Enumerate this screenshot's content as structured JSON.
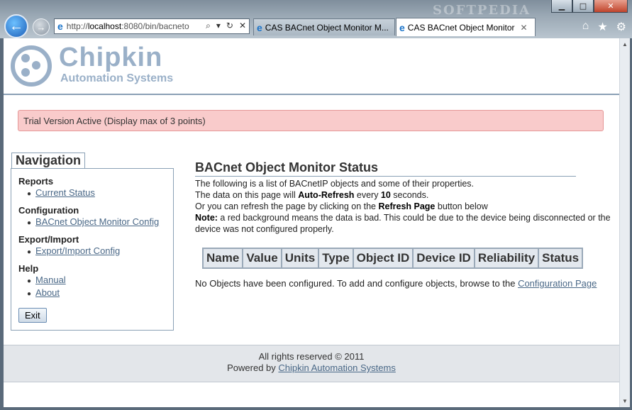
{
  "browser": {
    "address_url_prefix": "http://",
    "address_url_host": "localhost",
    "address_url_rest": ":8080/bin/bacneto",
    "tabs": [
      {
        "label": "CAS BACnet Object Monitor M..."
      },
      {
        "label": "CAS BACnet Object Monitor"
      }
    ],
    "watermark": "SOFTPEDIA"
  },
  "header": {
    "logo_title": "Chipkin",
    "logo_subtitle": "Automation Systems"
  },
  "trial_banner": "Trial Version Active (Display max of 3 points)",
  "navigation": {
    "title": "Navigation",
    "sections": [
      {
        "heading": "Reports",
        "links": [
          "Current Status"
        ]
      },
      {
        "heading": "Configuration",
        "links": [
          "BACnet Object Monitor Config"
        ]
      },
      {
        "heading": "Export/Import",
        "links": [
          "Export/Import Config"
        ]
      },
      {
        "heading": "Help",
        "links": [
          "Manual",
          "About"
        ]
      }
    ],
    "exit_label": "Exit"
  },
  "main": {
    "title": "BACnet Object Monitor Status",
    "line1": "The following is a list of BACnetIP objects and some of their properties.",
    "line2_a": "The data on this page will ",
    "line2_b": "Auto-Refresh",
    "line2_c": " every ",
    "line2_d": "10",
    "line2_e": " seconds.",
    "line3_a": "Or you can refresh the page by clicking on the ",
    "line3_b": "Refresh Page",
    "line3_c": " button below",
    "note_label": "Note:",
    "note_text": " a red background means the data is bad. This could be due to the device being disconnected or the device was not configured properly.",
    "table_headers": [
      "Name",
      "Value",
      "Units",
      "Type",
      "Object ID",
      "Device ID",
      "Reliability",
      "Status"
    ],
    "no_objects_text": "No Objects have been configured. To add and configure objects, browse to the ",
    "no_objects_link": "Configuration Page"
  },
  "footer": {
    "rights": "All rights reserved © 2011",
    "powered_by": "Powered by ",
    "powered_link": "Chipkin Automation Systems"
  },
  "colors": {
    "accent": "#9ab0c8",
    "link": "#4a6887",
    "trial_bg": "#f9cbcb"
  }
}
